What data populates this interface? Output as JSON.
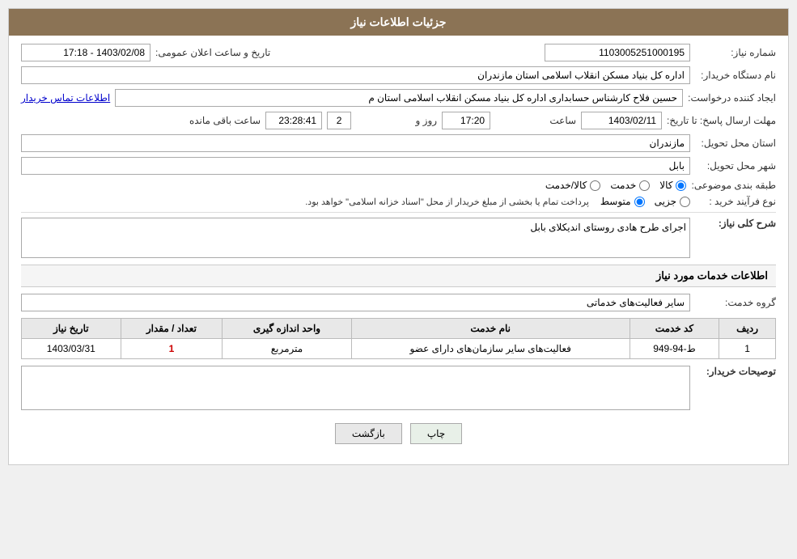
{
  "header": {
    "title": "جزئیات اطلاعات نیاز"
  },
  "fields": {
    "shomare_niaz_label": "شماره نیاز:",
    "shomare_niaz_value": "1103005251000195",
    "nam_dastgah_label": "نام دستگاه خریدار:",
    "nam_dastgah_value": "اداره کل بنیاد مسکن انقلاب اسلامی استان مازندران",
    "tarikh_label": "تاریخ و ساعت اعلان عمومی:",
    "tarikh_value": "1403/02/08 - 17:18",
    "ijad_label": "ایجاد کننده درخواست:",
    "ijad_value": "حسین فلاح کارشناس حسابداری اداره کل بنیاد مسکن انقلاب اسلامی استان م",
    "ijad_link": "اطلاعات تماس خریدار",
    "mohlat_label": "مهلت ارسال پاسخ: تا تاریخ:",
    "mohlat_date": "1403/02/11",
    "mohlat_saat_label": "ساعت",
    "mohlat_saat": "17:20",
    "mohlat_rooz_label": "روز و",
    "mohlat_rooz": "2",
    "mohlat_mande_label": "ساعت باقی مانده",
    "mohlat_mande": "23:28:41",
    "ostan_label": "استان محل تحویل:",
    "ostan_value": "مازندران",
    "shahr_label": "شهر محل تحویل:",
    "shahr_value": "بابل",
    "tabaqe_label": "طبقه بندی موضوعی:",
    "tabaqe_options": [
      "کالا/خدمت",
      "خدمت",
      "کالا"
    ],
    "tabaqe_selected": "کالا",
    "nooe_label": "نوع فرآیند خرید :",
    "nooe_options": [
      "جزیی",
      "متوسط"
    ],
    "nooe_selected": "متوسط",
    "nooe_description": "پرداخت تمام یا بخشی از مبلغ خریدار از محل \"اسناد خزانه اسلامی\" خواهد بود.",
    "sharh_label": "شرح کلی نیاز:",
    "sharh_value": "اجرای طرح هادی روستای اندیکلای بابل",
    "khadamat_label": "اطلاعات خدمات مورد نیاز",
    "grooh_label": "گروه خدمت:",
    "grooh_value": "سایر فعالیت‌های خدماتی",
    "table": {
      "headers": [
        "ردیف",
        "کد خدمت",
        "نام خدمت",
        "واحد اندازه گیری",
        "تعداد / مقدار",
        "تاریخ نیاز"
      ],
      "rows": [
        {
          "radif": "1",
          "kod": "ط-94-949",
          "nam": "فعالیت‌های سایر سازمان‌های دارای عضو",
          "vahed": "مترمربع",
          "tedad": "1",
          "tarikh": "1403/03/31"
        }
      ]
    },
    "tosif_label": "توصیحات خریدار:",
    "tosif_value": ""
  },
  "buttons": {
    "print_label": "چاپ",
    "back_label": "بازگشت"
  }
}
